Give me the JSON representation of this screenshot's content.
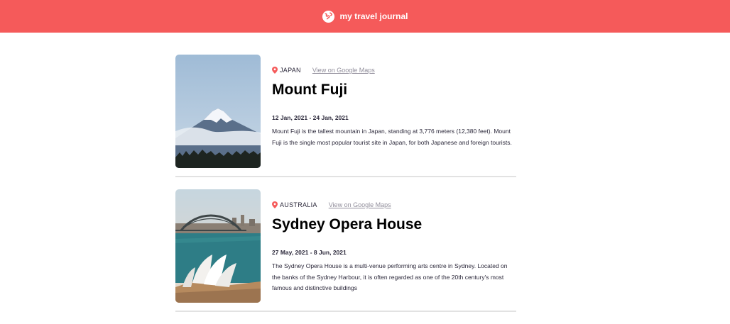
{
  "header": {
    "logo_icon": "globe-icon",
    "title": "my travel journal",
    "background": "#f55a5a"
  },
  "entries": [
    {
      "country": "JAPAN",
      "map_link": "View on Google Maps",
      "title": "Mount Fuji",
      "dates": "12 Jan, 2021 - 24 Jan, 2021",
      "description": "Mount Fuji is the tallest mountain in Japan, standing at 3,776 meters (12,380 feet). Mount Fuji is the single most popular tourist site in Japan, for both Japanese and foreign tourists.",
      "image": "mount-fuji-photo"
    },
    {
      "country": "AUSTRALIA",
      "map_link": "View on Google Maps",
      "title": "Sydney Opera House",
      "dates": "27 May, 2021 - 8 Jun, 2021",
      "description": "The Sydney Opera House is a multi-venue performing arts centre in Sydney. Located on the banks of the Sydney Harbour, it is often regarded as one of the 20th century's most famous and distinctive buildings",
      "image": "sydney-opera-house-photo"
    }
  ],
  "colors": {
    "accent": "#f55a5a",
    "text": "#2b283a",
    "muted": "#918e9b"
  }
}
